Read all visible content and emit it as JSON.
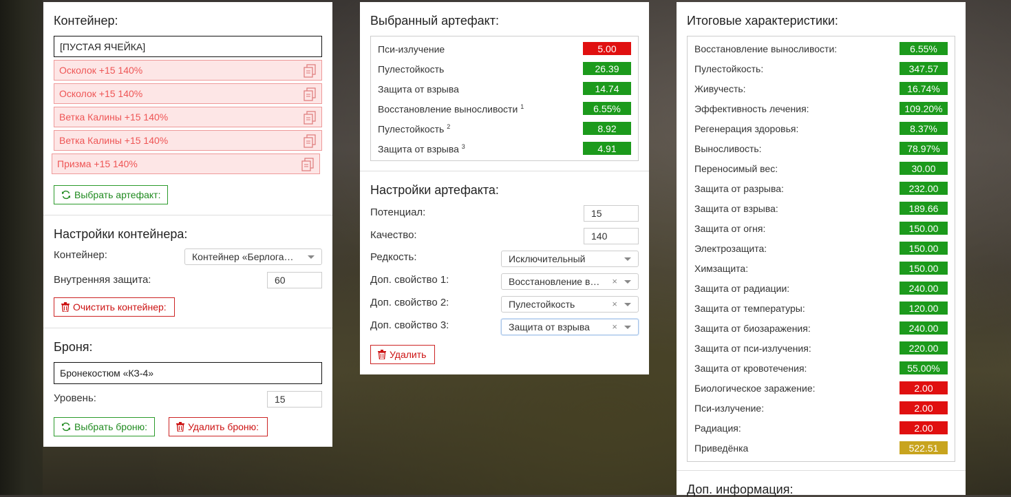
{
  "container_panel": {
    "title": "Контейнер:",
    "empty_slot": "[ПУСТАЯ ЯЧЕЙКА]",
    "slots": [
      "Осколок +15 140%",
      "Осколок +15 140%",
      "Ветка Калины +15 140%",
      "Ветка Калины +15 140%",
      "Призма +15 140%"
    ],
    "select_button": "Выбрать артефакт:",
    "settings_title": "Настройки контейнера:",
    "container_label": "Контейнер:",
    "container_value": "Контейнер «Берлога…",
    "inner_protection_label": "Внутренняя защита:",
    "inner_protection_value": "60",
    "clear_button": "Очистить контейнер:",
    "armor_title": "Броня:",
    "armor_value": "Бронекостюм «КЗ-4»",
    "level_label": "Уровень:",
    "level_value": "15",
    "select_armor_button": "Выбрать броню:",
    "delete_armor_button": "Удалить броню:"
  },
  "artifact_panel": {
    "title": "Выбранный артефакт:",
    "stats": [
      {
        "label": "Пси-излучение",
        "sup": "",
        "value": "5.00",
        "color": "red"
      },
      {
        "label": "Пулестойкость",
        "sup": "",
        "value": "26.39",
        "color": "green"
      },
      {
        "label": "Защита от взрыва",
        "sup": "",
        "value": "14.74",
        "color": "green"
      },
      {
        "label": "Восстановление выносливости",
        "sup": "1",
        "value": "6.55%",
        "color": "green"
      },
      {
        "label": "Пулестойкость",
        "sup": "2",
        "value": "8.92",
        "color": "green"
      },
      {
        "label": "Защита от взрыва",
        "sup": "3",
        "value": "4.91",
        "color": "green"
      }
    ],
    "settings_title": "Настройки артефакта:",
    "potential_label": "Потенциал:",
    "potential_value": "15",
    "quality_label": "Качество:",
    "quality_value": "140",
    "rarity_label": "Редкость:",
    "rarity_value": "Исключительный",
    "prop1_label": "Доп. свойство 1:",
    "prop1_value": "Восстановление в…",
    "prop2_label": "Доп. свойство 2:",
    "prop2_value": "Пулестойкость",
    "prop3_label": "Доп. свойство 3:",
    "prop3_value": "Защита от взрыва",
    "delete_button": "Удалить"
  },
  "totals_panel": {
    "title": "Итоговые характеристики:",
    "stats": [
      {
        "label": "Восстановление выносливости:",
        "value": "6.55%",
        "color": "green"
      },
      {
        "label": "Пулестойкость:",
        "value": "347.57",
        "color": "green"
      },
      {
        "label": "Живучесть:",
        "value": "16.74%",
        "color": "green"
      },
      {
        "label": "Эффективность лечения:",
        "value": "109.20%",
        "color": "green"
      },
      {
        "label": "Регенерация здоровья:",
        "value": "8.37%",
        "color": "green"
      },
      {
        "label": "Выносливость:",
        "value": "78.97%",
        "color": "green"
      },
      {
        "label": "Переносимый вес:",
        "value": "30.00",
        "color": "green"
      },
      {
        "label": "Защита от разрыва:",
        "value": "232.00",
        "color": "green"
      },
      {
        "label": "Защита от взрыва:",
        "value": "189.66",
        "color": "green"
      },
      {
        "label": "Защита от огня:",
        "value": "150.00",
        "color": "green"
      },
      {
        "label": "Электрозащита:",
        "value": "150.00",
        "color": "green"
      },
      {
        "label": "Химзащита:",
        "value": "150.00",
        "color": "green"
      },
      {
        "label": "Защита от радиации:",
        "value": "240.00",
        "color": "green"
      },
      {
        "label": "Защита от температуры:",
        "value": "120.00",
        "color": "green"
      },
      {
        "label": "Защита от биозаражения:",
        "value": "240.00",
        "color": "green"
      },
      {
        "label": "Защита от пси-излучения:",
        "value": "220.00",
        "color": "green"
      },
      {
        "label": "Защита от кровотечения:",
        "value": "55.00%",
        "color": "green"
      },
      {
        "label": "Биологическое заражение:",
        "value": "2.00",
        "color": "red"
      },
      {
        "label": "Пси-излучение:",
        "value": "2.00",
        "color": "red"
      },
      {
        "label": "Радиация:",
        "value": "2.00",
        "color": "red"
      },
      {
        "label": "Приведёнка",
        "value": "522.51",
        "color": "yellow"
      }
    ],
    "extra_title": "Доп. информация:"
  },
  "colors": {
    "green": "#1c9a1c",
    "red": "#e01010",
    "yellow": "#c8a41e"
  }
}
